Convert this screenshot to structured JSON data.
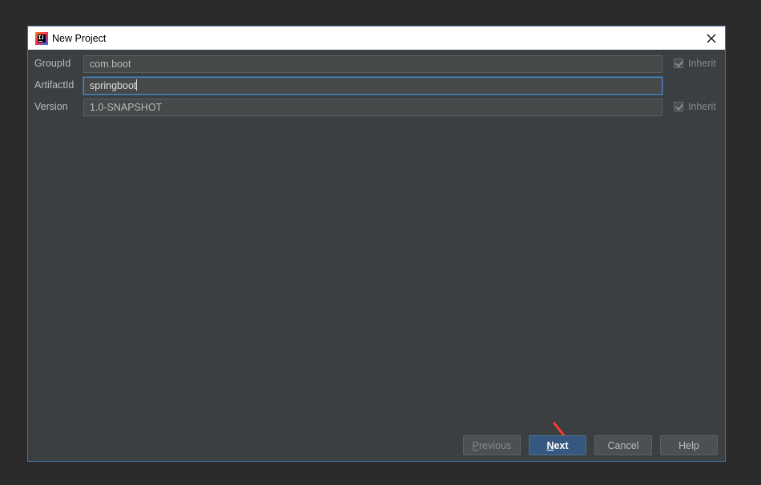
{
  "window": {
    "title": "New Project",
    "app_icon": "intellij-idea-icon",
    "close_icon": "close-icon"
  },
  "form": {
    "group_id": {
      "label": "GroupId",
      "value": "com.boot",
      "inherit_label": "Inherit",
      "inherit_checked": true
    },
    "artifact_id": {
      "label": "ArtifactId",
      "value": "springboot"
    },
    "version": {
      "label": "Version",
      "value": "1.0-SNAPSHOT",
      "inherit_label": "Inherit",
      "inherit_checked": true
    }
  },
  "buttons": {
    "previous": {
      "mnemonic": "P",
      "rest": "revious"
    },
    "next": {
      "mnemonic": "N",
      "rest": "ext"
    },
    "cancel": "Cancel",
    "help": "Help"
  },
  "colors": {
    "dialog_bg": "#3c3f41",
    "field_bg": "#45494a",
    "accent_blue": "#365880",
    "annotation_arrow": "#ff3b30"
  }
}
